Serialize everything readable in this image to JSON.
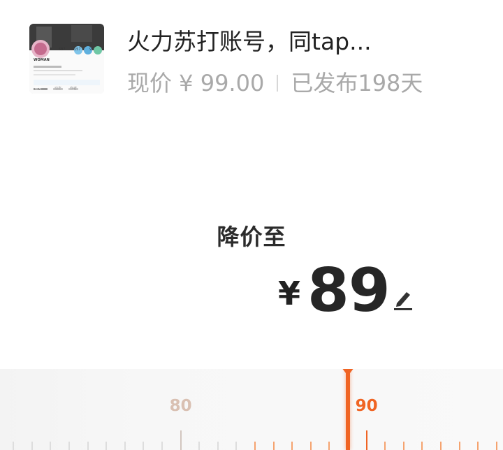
{
  "item": {
    "title": "火力苏打账号，同tap...",
    "current_price": "现价 ¥ 99.00",
    "published": "已发布198天",
    "thumbnail": {
      "profile_name": "WOMAN",
      "stats": [
        "587",
        "157",
        "95"
      ],
      "tabs": [
        "账号",
        "动态",
        "作者"
      ]
    }
  },
  "reduce": {
    "label": "降价至",
    "currency": "¥",
    "value": "89",
    "edit_icon": "pencil-icon"
  },
  "slider": {
    "labels": [
      {
        "text": "80",
        "value": 80
      },
      {
        "text": "90",
        "value": 90
      }
    ],
    "selected_value": 89,
    "min_visible": 70,
    "max_visible": 97,
    "colors": {
      "accent": "#f06423",
      "tick_active": "#f5a36f",
      "tick_inactive": "#dddddd",
      "label_inactive": "#d9c0b2"
    }
  }
}
